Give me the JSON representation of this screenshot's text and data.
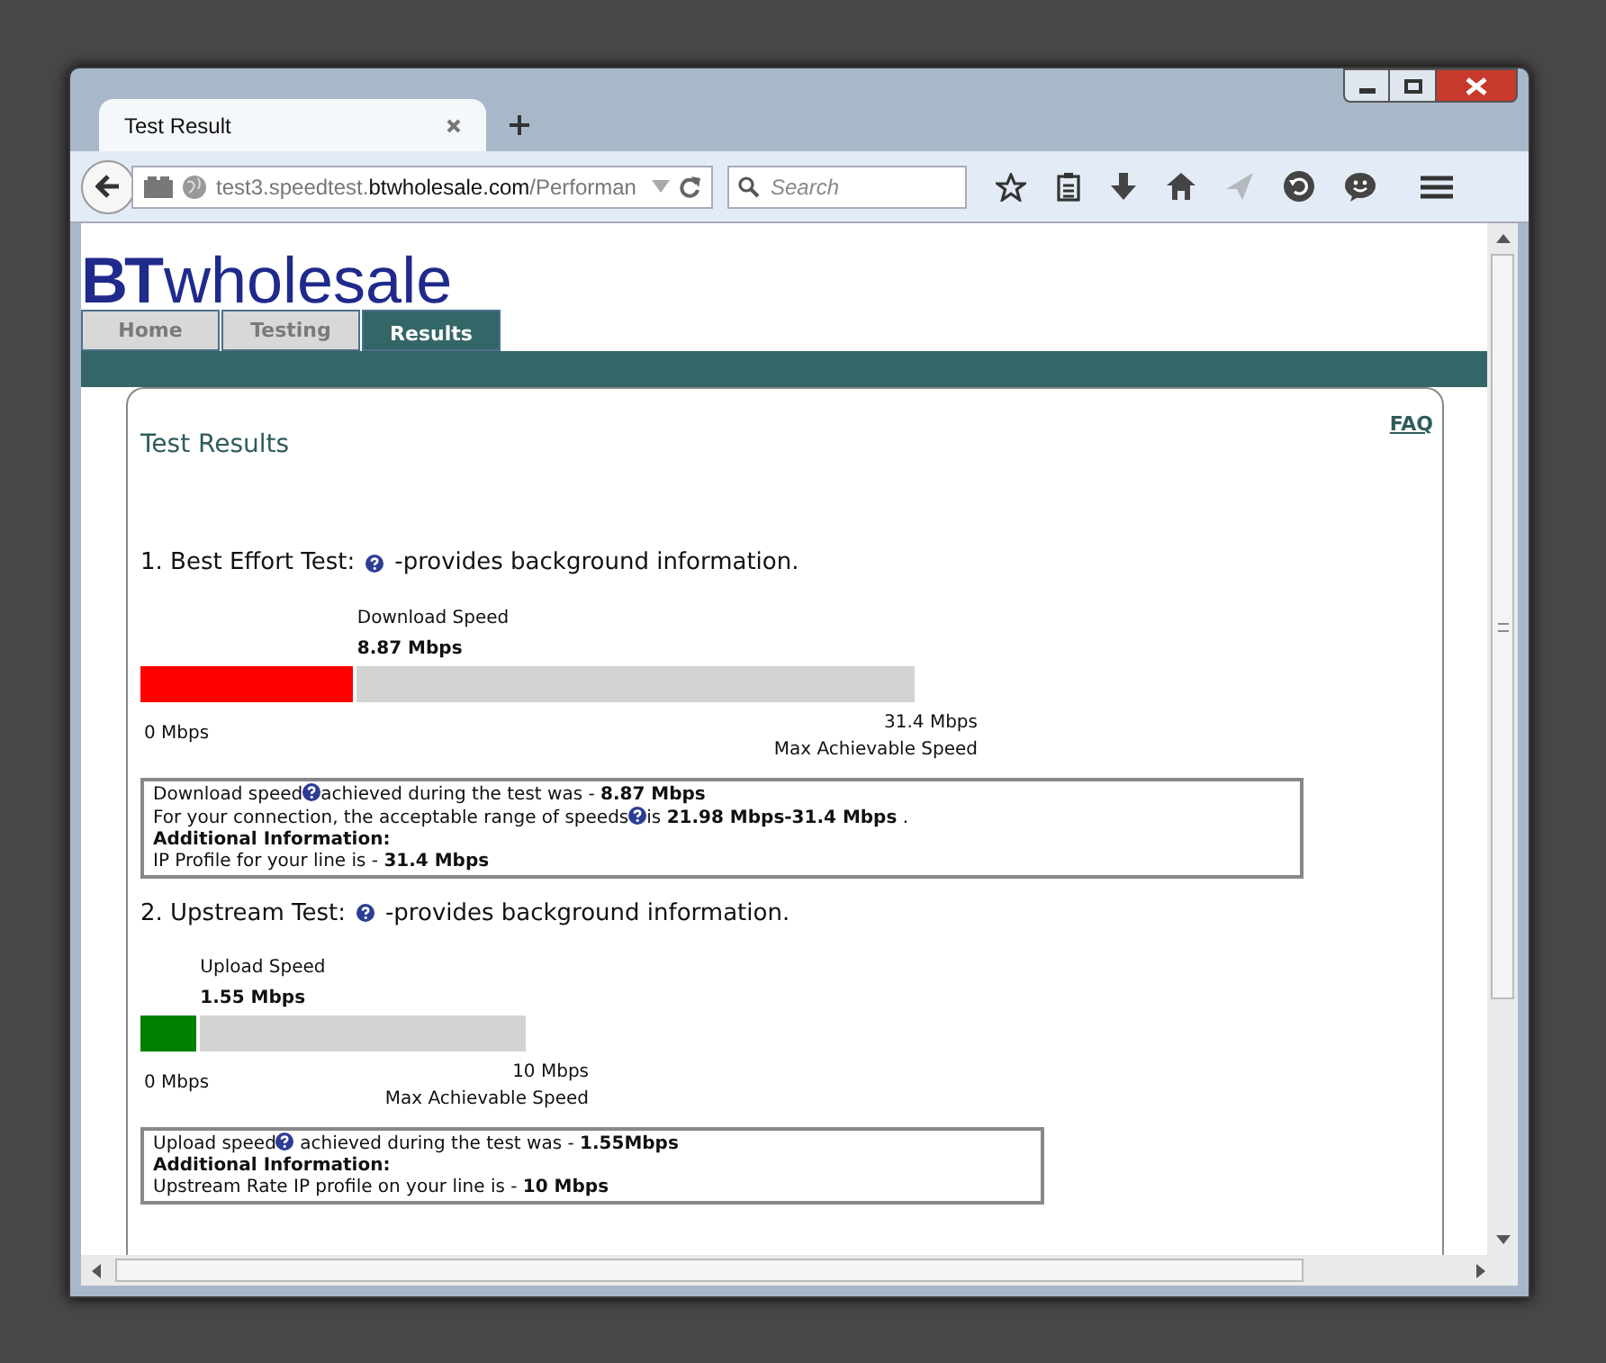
{
  "browser": {
    "tab_title": "Test Result",
    "url": {
      "prefix": "test3.speedtest.",
      "domain": "btwholesale.com",
      "path": "/Performan"
    },
    "search": {
      "placeholder": "Search"
    }
  },
  "site": {
    "logo": {
      "mark": "BT",
      "word": "wholesale"
    },
    "nav": [
      {
        "label": "Home",
        "selected": false
      },
      {
        "label": "Testing",
        "selected": false
      },
      {
        "label": "Results",
        "selected": true
      }
    ],
    "faq": "FAQ",
    "heading": "Test Results",
    "tests": [
      {
        "title": "1. Best Effort Test:",
        "subtitle": "-provides background information.",
        "gauge": {
          "label": "Download Speed",
          "value": "8.87 Mbps",
          "level": 0.28,
          "color": "#ff0000",
          "min": "0 Mbps",
          "max": "31.4 Mbps",
          "max_caption": "Max Achievable Speed"
        },
        "info": [
          {
            "kind": "text",
            "parts": [
              "Download speed",
              "achieved during the test was - **8.87 Mbps**"
            ]
          },
          {
            "kind": "text",
            "parts": [
              "For your connection, the acceptable range of speeds",
              "is **21.98 Mbps-31.4 Mbps** ."
            ]
          },
          {
            "kind": "heading",
            "parts": [
              "Additional Information:"
            ]
          },
          {
            "kind": "text",
            "parts": [
              "IP Profile for your line is - **31.4 Mbps**"
            ]
          }
        ]
      },
      {
        "title": "2. Upstream Test:",
        "subtitle": "-provides background information.",
        "gauge": {
          "label": "Upload Speed",
          "value": "1.55 Mbps",
          "level": 0.155,
          "color": "#008000",
          "min": "0 Mbps",
          "max": "10 Mbps",
          "max_caption": "Max Achievable Speed"
        },
        "info": [
          {
            "kind": "text",
            "parts": [
              "Upload speed",
              " achieved during the test was - **1.55Mbps**"
            ]
          },
          {
            "kind": "heading",
            "parts": [
              "Additional Information:"
            ]
          },
          {
            "kind": "text",
            "parts": [
              "Upstream Rate IP profile on your line is - **10 Mbps**"
            ]
          }
        ]
      }
    ]
  }
}
